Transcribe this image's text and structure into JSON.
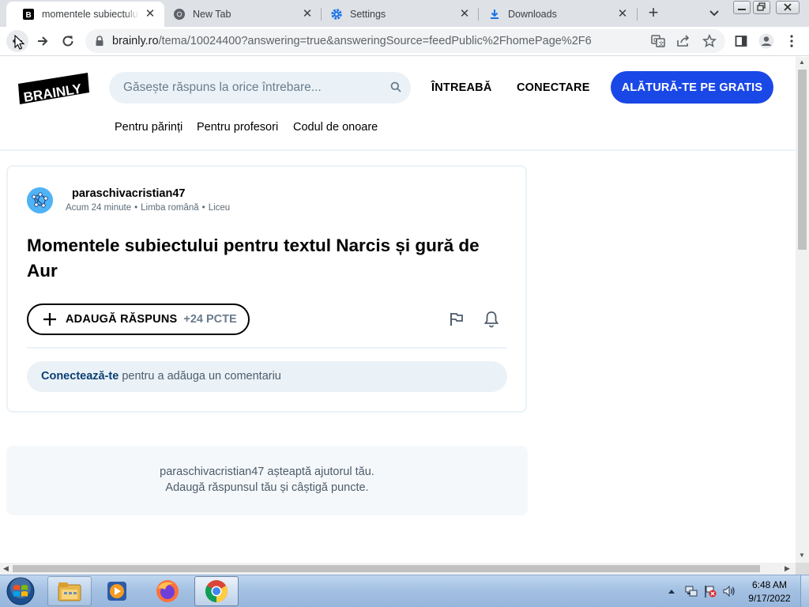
{
  "browser": {
    "tabs": [
      {
        "title": "momentele subiectului pentru textul Narcis și gură de Aur",
        "favicon": "brainly-favicon",
        "active": true
      },
      {
        "title": "New Tab",
        "favicon": "chrome-favicon",
        "active": false
      },
      {
        "title": "Settings",
        "favicon": "settings-gear-icon",
        "active": false
      },
      {
        "title": "Downloads",
        "favicon": "download-icon",
        "active": false
      }
    ],
    "new_tab_glyph": "+",
    "close_glyph": "✕",
    "omnibox": {
      "host": "brainly.ro",
      "path": "/tema/10024400?answering=true&answeringSource=feedPublic%2FhomePage%2F6"
    }
  },
  "page": {
    "logo_text": "BRAINLY",
    "search_placeholder": "Găsește răspuns la orice întrebare...",
    "nav": {
      "ask": "ÎNTREABĂ",
      "login": "CONECTARE",
      "join": "ALĂTURĂ-TE PE GRATIS"
    },
    "subnav": [
      "Pentru părinți",
      "Pentru profesori",
      "Codul de onoare"
    ],
    "question": {
      "username": "paraschivacristian47",
      "time": "Acum 24 minute",
      "subject": "Limba română",
      "level": "Liceu",
      "title": "Momentele subiectului pentru textul Narcis și gură de Aur",
      "answer_button": "ADAUGĂ RĂSPUNS",
      "points": "+24 PCTE",
      "comment_link": "Conectează-te",
      "comment_text": " pentru a adăuga un comentariu"
    },
    "waiting": {
      "line1": "paraschivacristian47 așteaptă ajutorul tău.",
      "line2": "Adaugă răspunsul tău și câștigă puncte."
    }
  },
  "taskbar": {
    "clock_time": "6:48 AM",
    "clock_date": "9/17/2022",
    "apps": [
      "file-explorer-icon",
      "media-player-icon",
      "firefox-icon",
      "chrome-icon"
    ]
  },
  "colors": {
    "brand_blue": "#1a48e6",
    "light_bg": "#ebf2f7",
    "tab_strip": "#dee1e6"
  }
}
